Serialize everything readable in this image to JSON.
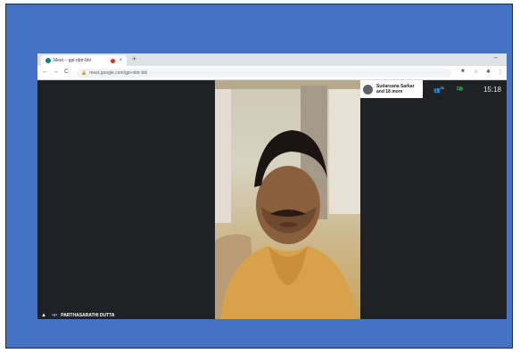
{
  "browser": {
    "tab_title": "Meet – gpi-nbtr-bbi",
    "tab_close": "×",
    "new_tab": "+",
    "minimize": "–",
    "nav_back": "←",
    "nav_forward": "→",
    "nav_reload": "C",
    "url": "meet.google.com/gpi-nbtr-bbi",
    "lock_icon": "🔒",
    "icons": [
      "video-camera-icon",
      "star-icon",
      "extensions-icon",
      "menu-icon"
    ]
  },
  "meet": {
    "people_name": "Sudarsana Sarkar",
    "people_more": "and 18 more",
    "participant_count": "21",
    "chat_badge_color": "#1e8e3e",
    "time": "15:18",
    "speaker_name": "PARTHASARATHI DUTTA"
  },
  "colors": {
    "frame_bg": "#4472c4",
    "meet_bg": "#202124",
    "accent": "#8ab4f8"
  }
}
